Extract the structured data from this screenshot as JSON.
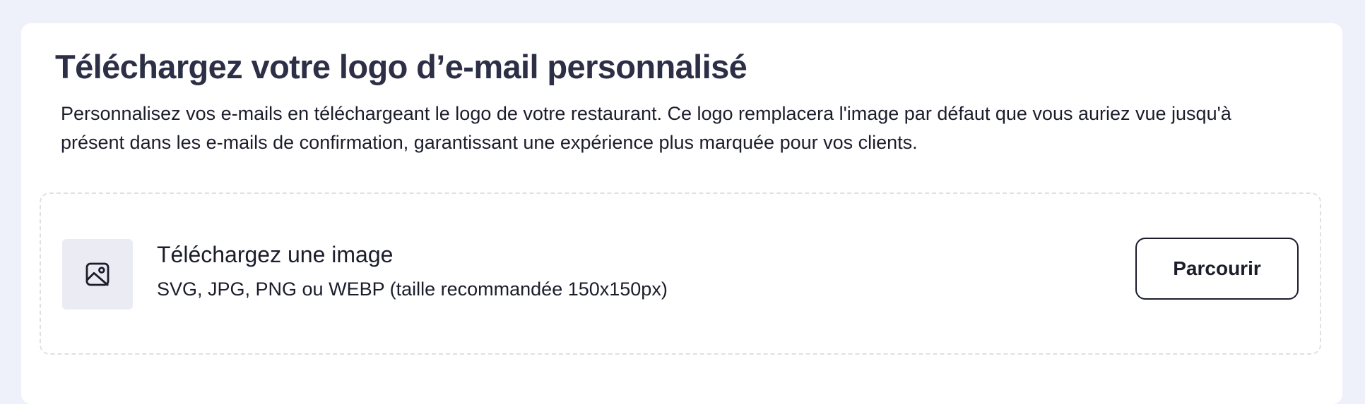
{
  "card": {
    "title": "Téléchargez votre logo d’e-mail personnalisé",
    "description": "Personnalisez vos e-mails en téléchargeant le logo de votre restaurant. Ce logo remplacera l'image par défaut que vous auriez vue jusqu'à présent dans les e-mails de confirmation, garantissant une expérience plus marquée pour vos clients."
  },
  "upload": {
    "icon": "image-icon",
    "title": "Téléchargez une image",
    "hint": "SVG, JPG, PNG ou WEBP (taille recommandée 150x150px)",
    "browse_label": "Parcourir"
  },
  "colors": {
    "page_background": "#eef1fa",
    "card_background": "#ffffff",
    "title_text": "#2c2f45",
    "body_text": "#1b1d2b",
    "dropzone_border": "#dfe0e6",
    "thumbnail_background": "#ebebf3"
  }
}
